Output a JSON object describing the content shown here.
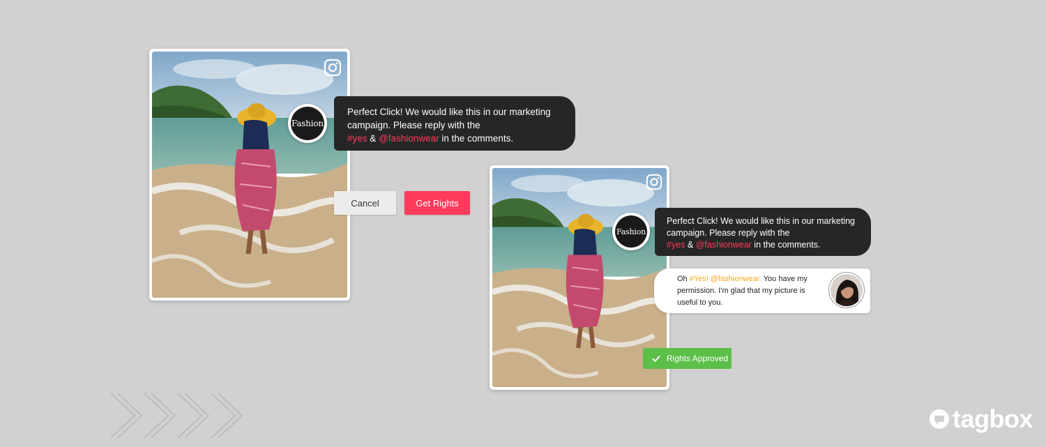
{
  "request_post": {
    "brand_avatar_text": "Fashion",
    "message": {
      "line1": "Perfect Click! We would like this in our marketing",
      "line2": "campaign. Please reply with the",
      "hashtag": "#yes",
      "amp": "&",
      "mention": "@fashionwear",
      "suffix": "in the comments."
    },
    "cancel_label": "Cancel",
    "get_rights_label": "Get Rights"
  },
  "approved_post": {
    "brand_avatar_text": "Fashion",
    "message": {
      "line1": "Perfect Click! We would like this in our marketing",
      "line2": "campaign. Please reply with the",
      "hashtag": "#yes",
      "amp": "&",
      "mention": "@fashionwear",
      "suffix": "in the comments."
    },
    "reply": {
      "prefix": "Oh",
      "highlight": "#Yes! @fashionwear.",
      "line1_rest": "You have my",
      "line2": "permission. I'm glad that my picture is",
      "line3": "useful to you."
    },
    "status_label": "Rights Approved"
  },
  "logo_text": "tagbox",
  "colors": {
    "background": "#d1d1d1",
    "accent_red": "#ff3b5c",
    "bubble_dark": "#262626",
    "approved_green": "#5cbf4a",
    "reply_highlight": "#f5a623"
  },
  "icons": [
    "instagram-icon",
    "check-icon",
    "chevron-right-icon",
    "tagbox-logo-icon"
  ]
}
